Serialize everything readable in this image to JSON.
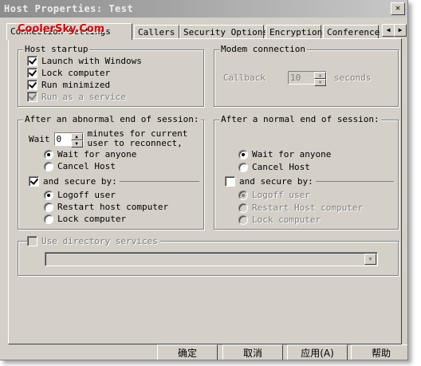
{
  "window": {
    "title": "Host Properties: Test",
    "close_glyph": "✕"
  },
  "watermark": "CoolerSky.Com",
  "tabs": [
    {
      "label": "Connection Settings",
      "active": true
    },
    {
      "label": "Callers",
      "active": false
    },
    {
      "label": "Security Options",
      "active": false
    },
    {
      "label": "Encryption",
      "active": false
    },
    {
      "label": "Conference",
      "active": false
    }
  ],
  "tab_scroll": {
    "left": "◀",
    "right": "▶"
  },
  "host_startup": {
    "legend": "Host startup",
    "items": [
      {
        "label": "Launch with Windows",
        "checked": true,
        "enabled": true
      },
      {
        "label": "Lock computer",
        "checked": true,
        "enabled": true
      },
      {
        "label": "Run minimized",
        "checked": true,
        "enabled": true
      },
      {
        "label": "Run as a service",
        "checked": true,
        "enabled": false
      }
    ]
  },
  "modem": {
    "legend": "Modem connection",
    "callback_label": "Callback",
    "callback_value": "10",
    "seconds_label": "seconds"
  },
  "abnormal_end": {
    "legend": "After an abnormal end of session:",
    "wait_label": "Wait",
    "wait_value": "0",
    "minutes_text_1": "minutes for current",
    "minutes_text_2": "user to reconnect,",
    "options": [
      {
        "label": "Wait for anyone",
        "selected": true
      },
      {
        "label": "Cancel Host",
        "selected": false
      }
    ],
    "secure": {
      "label": "and secure by:",
      "checked": true,
      "options": [
        {
          "label": "Logoff user",
          "selected": true
        },
        {
          "label": "Restart host computer",
          "selected": false
        },
        {
          "label": "Lock computer",
          "selected": false
        }
      ]
    }
  },
  "normal_end": {
    "legend": "After a normal end of session:",
    "options": [
      {
        "label": "Wait for anyone",
        "selected": true
      },
      {
        "label": "Cancel Host",
        "selected": false
      }
    ],
    "secure": {
      "label": "and secure by:",
      "checked": false,
      "options": [
        {
          "label": "Logoff user",
          "selected": true
        },
        {
          "label": "Restart Host computer",
          "selected": false
        },
        {
          "label": "Lock computer",
          "selected": false
        }
      ]
    }
  },
  "directory": {
    "label": "Use directory services",
    "checked": false,
    "enabled": false,
    "combo_value": ""
  },
  "buttons": {
    "ok": "确定",
    "cancel": "取消",
    "apply": "应用(A)",
    "help": "帮助"
  },
  "colors": {
    "face": "#d4d0c8",
    "shadow": "#808080",
    "watermark": "#e00000"
  }
}
